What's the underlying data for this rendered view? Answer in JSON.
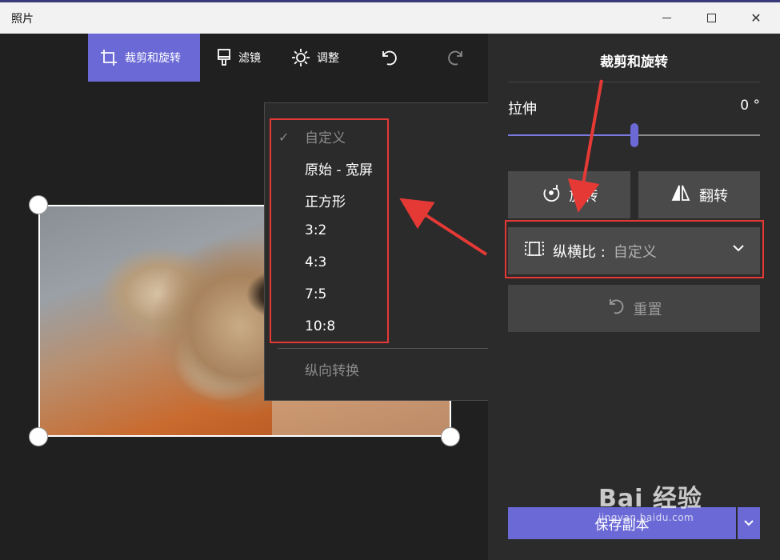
{
  "window": {
    "title": "照片"
  },
  "toolbar": {
    "crop_label": "裁剪和旋转",
    "filter_label": "滤镜",
    "adjust_label": "调整"
  },
  "menu": {
    "items": [
      {
        "label": "自定义",
        "checked": true,
        "dim": true
      },
      {
        "label": "原始 - 宽屏"
      },
      {
        "label": "正方形"
      },
      {
        "label": "3:2"
      },
      {
        "label": "4:3"
      },
      {
        "label": "7:5"
      },
      {
        "label": "10:8"
      }
    ],
    "portrait_label": "纵向转换"
  },
  "panel": {
    "title": "裁剪和旋转",
    "stretch_label": "拉伸",
    "stretch_value": "0 °",
    "stretch_level": 0.5,
    "rotate_label": "旋转",
    "flip_label": "翻转",
    "aspect_label": "纵横比 :",
    "aspect_value": "自定义",
    "reset_label": "重置",
    "save_label": "保存副本"
  },
  "watermark": {
    "text": "Bai 经验",
    "url": "jingyan.baidu.com"
  },
  "colors": {
    "accent": "#6b69d6",
    "annotation": "#e53935",
    "panel_bg": "#2b2b2b"
  },
  "icons": [
    "crop-icon",
    "brush-icon",
    "brightness-icon",
    "undo-icon",
    "redo-icon",
    "rotate-icon",
    "flip-icon",
    "aspect-ratio-icon",
    "chevron-down-icon",
    "reset-icon",
    "check-icon"
  ]
}
